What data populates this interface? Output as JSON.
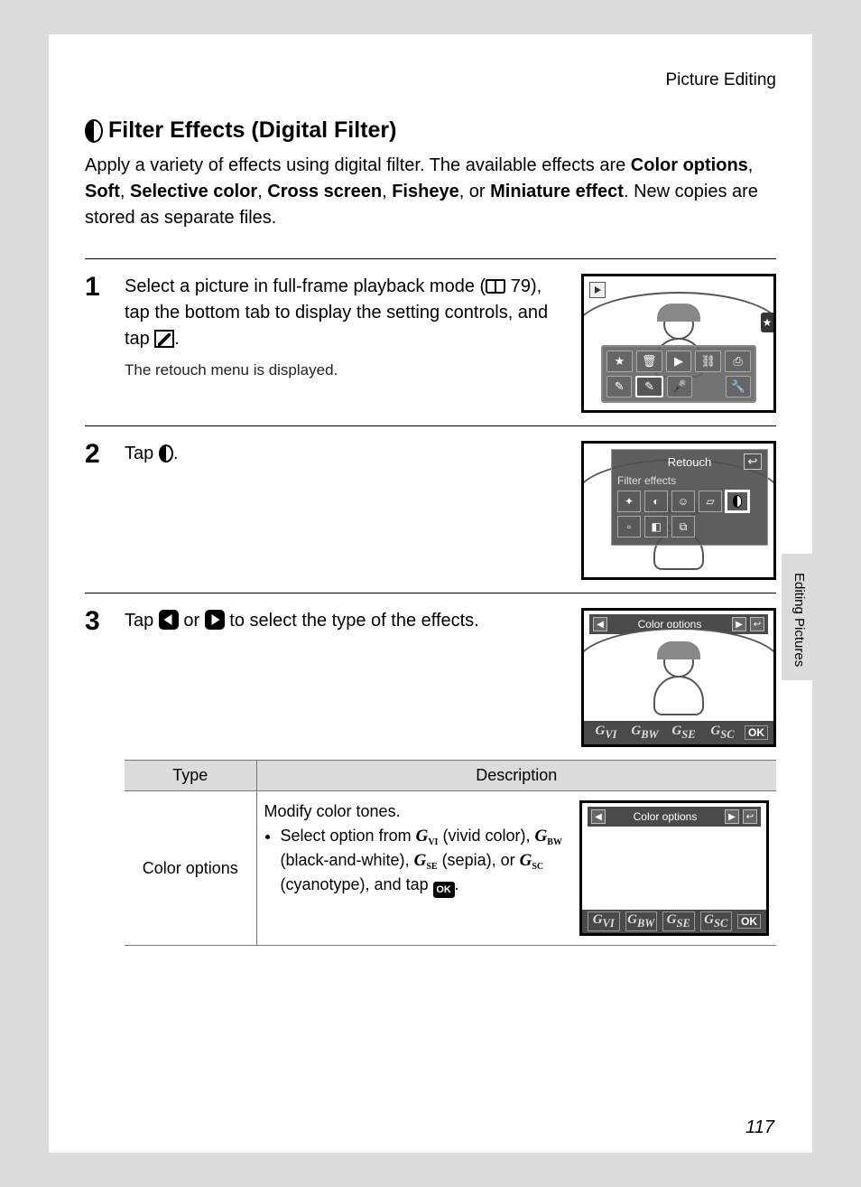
{
  "header": {
    "section": "Picture Editing"
  },
  "title": "Filter Effects (Digital Filter)",
  "intro": {
    "lead": "Apply a variety of effects using digital filter. The available effects are ",
    "effects": [
      "Color options",
      "Soft",
      "Selective color",
      "Cross screen",
      "Fisheye",
      "Miniature effect"
    ],
    "tail": ". New copies are stored as separate files."
  },
  "steps": [
    {
      "num": "1",
      "text_pre": "Select a picture in full-frame playback mode (",
      "ref": "79",
      "text_mid": "), tap the bottom tab to display the setting controls, and tap ",
      "text_post": ".",
      "sub": "The retouch menu is displayed."
    },
    {
      "num": "2",
      "text": "Tap ",
      "text_post": ".",
      "screen_title": "Retouch",
      "screen_sub": "Filter effects"
    },
    {
      "num": "3",
      "text_pre": "Tap ",
      "text_mid": " or ",
      "text_post": " to select the type of the effects.",
      "screen_label": "Color options",
      "ok": "OK"
    }
  ],
  "table": {
    "headers": [
      "Type",
      "Description"
    ],
    "row": {
      "type": "Color options",
      "desc_lead": "Modify color tones.",
      "bullet_pre": "Select option from ",
      "opts": [
        {
          "code": "VI",
          "label": "(vivid color)"
        },
        {
          "code": "BW",
          "label": "(black-and-white)"
        },
        {
          "code": "SE",
          "label": "(sepia)"
        },
        {
          "code": "SC",
          "label": "(cyanotype)"
        }
      ],
      "bullet_post": ", and tap ",
      "ok": "OK",
      "screen_label": "Color options"
    }
  },
  "side_label": "Editing Pictures",
  "page_number": "117"
}
